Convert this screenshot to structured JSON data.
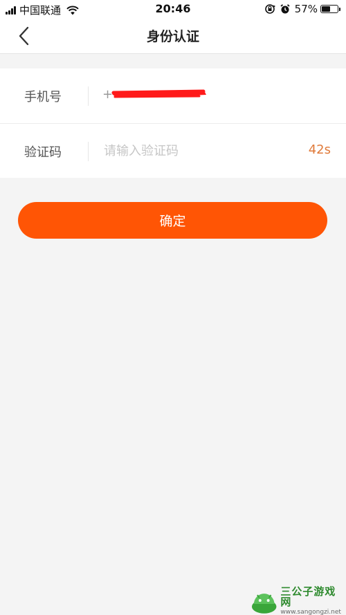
{
  "status_bar": {
    "carrier": "中国联通",
    "time": "20:46",
    "battery_percent": "57%",
    "battery_level": 0.57
  },
  "nav": {
    "title": "身份认证",
    "back_icon": "chevron-left-icon"
  },
  "form": {
    "phone": {
      "label": "手机号",
      "value_prefix": "+"
    },
    "code": {
      "label": "验证码",
      "placeholder": "请输入验证码",
      "value": "",
      "countdown": "42s"
    }
  },
  "confirm_button": {
    "label": "确定"
  },
  "colors": {
    "accent": "#ff5505",
    "countdown": "#e07a3a",
    "background": "#f4f4f4"
  }
}
